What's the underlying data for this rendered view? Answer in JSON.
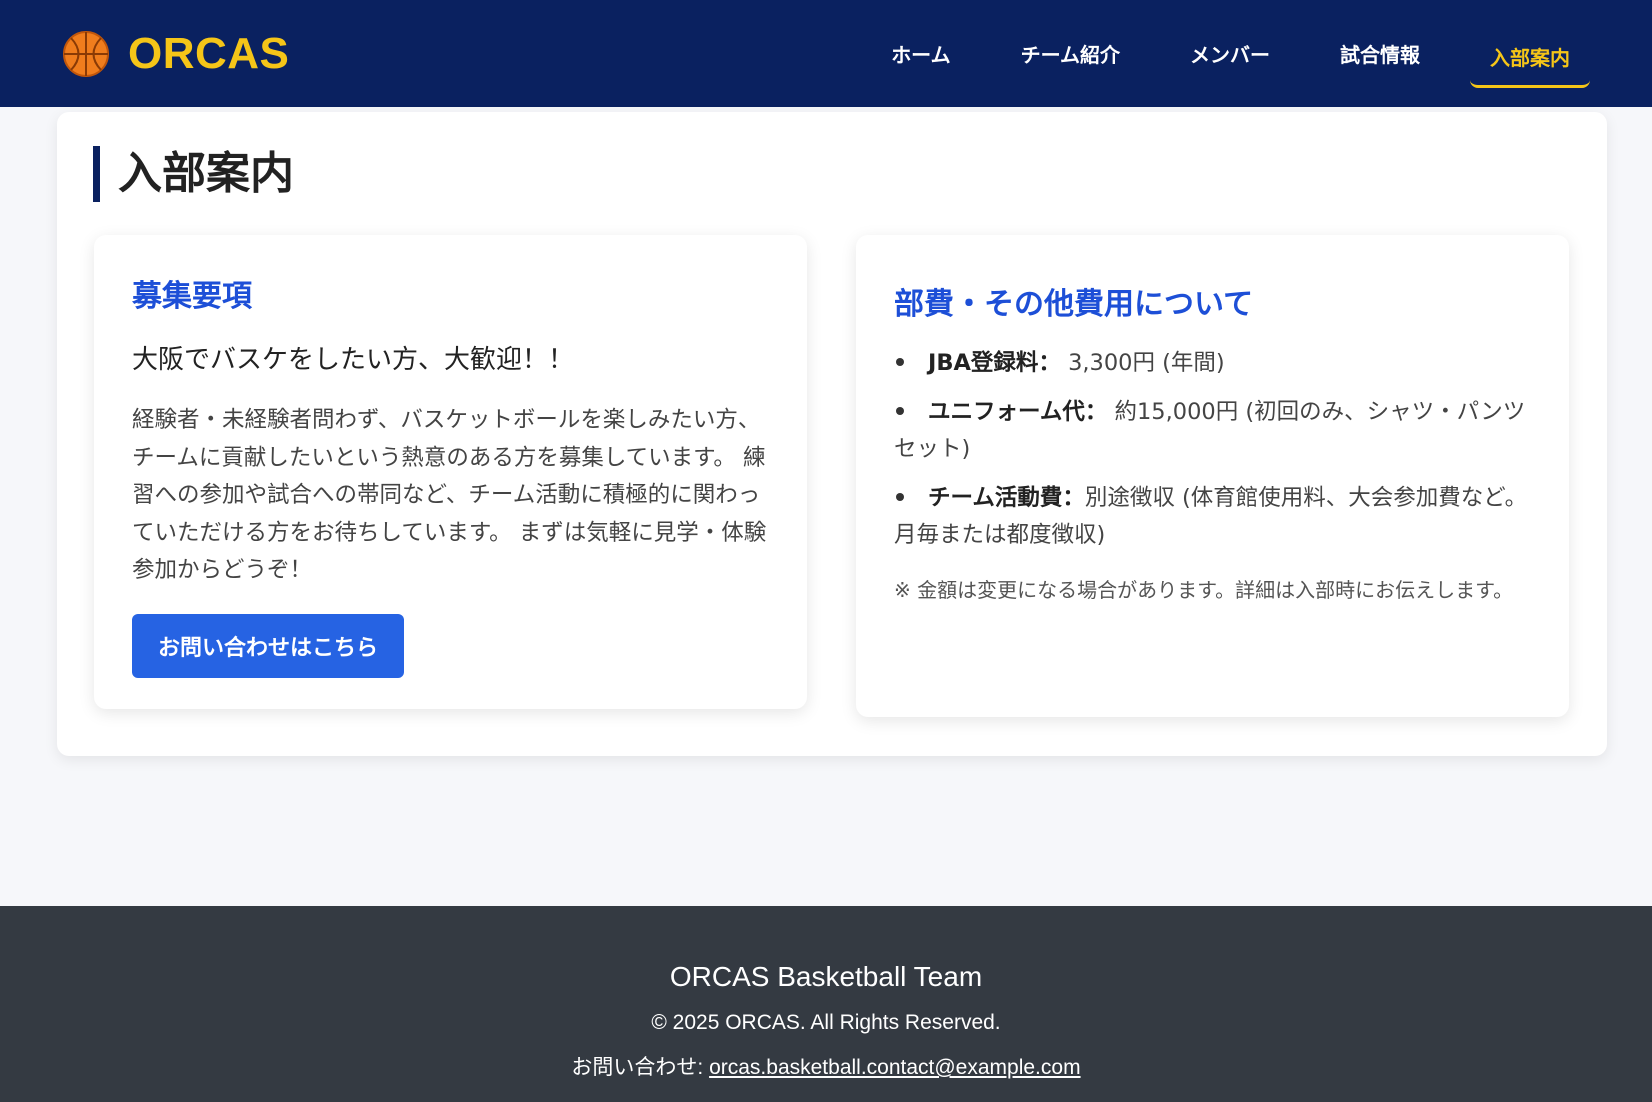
{
  "header": {
    "brand": "ORCAS",
    "nav": [
      "ホーム",
      "チーム紹介",
      "メンバー",
      "試合情報",
      "入部案内"
    ],
    "active_nav": "入部案内"
  },
  "page": {
    "title": "入部案内"
  },
  "recruit": {
    "heading": "募集要項",
    "lead": "大阪でバスケをしたい方、大歓迎！！",
    "description": "経験者・未経験者問わず、バスケットボールを楽しみたい方、チームに貢献したいという熱意のある方を募集しています。 練習への参加や試合への帯同など、チーム活動に積極的に関わっていただける方をお待ちしています。 まずは気軽に見学・体験参加からどうぞ！",
    "button": "お問い合わせはこちら"
  },
  "fees": {
    "heading": "部費・その他費用について",
    "items": [
      {
        "label": "JBA登録料：",
        "value": " 3,300円 (年間)"
      },
      {
        "label": "ユニフォーム代：",
        "value": " 約15,000円 (初回のみ、シャツ・パンツセット)"
      },
      {
        "label": "チーム活動費：",
        "value": "別途徴収 (体育館使用料、大会参加費など。月毎または都度徴収)"
      }
    ],
    "note": "※ 金額は変更になる場合があります。詳細は入部時にお伝えします。"
  },
  "footer": {
    "title": "ORCAS Basketball Team",
    "copyright": "© 2025 ORCAS. All Rights Reserved.",
    "contact_label": "お問い合わせ: ",
    "contact_email": "orcas.basketball.contact@example.com"
  },
  "colors": {
    "navbar": "#0a2160",
    "brand": "#f5c518",
    "accent": "#1d4fd7",
    "button": "#2663e3",
    "footer": "#343a42"
  },
  "icons": {
    "brand": "basketball-icon"
  }
}
